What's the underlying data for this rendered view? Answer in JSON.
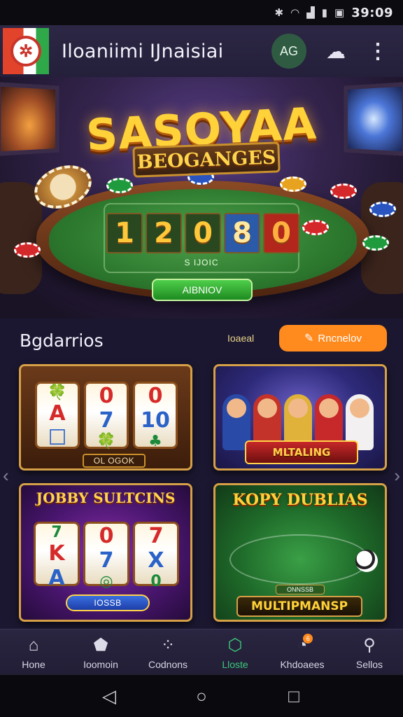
{
  "status_bar": {
    "time": "39:09",
    "icons": [
      "bluetooth-icon",
      "wifi-icon",
      "signal-icon",
      "battery-icon",
      "vibrate-icon"
    ]
  },
  "app_bar": {
    "title": "Iloaniimi IJnaisiai",
    "avatar_initials": "AG",
    "settings_icon": "settings-cloud-icon",
    "more_icon": "more-vertical-icon"
  },
  "hero": {
    "title": "SASOYAA",
    "subtitle": "BEOGANGES",
    "digits": [
      "1",
      "2",
      "0",
      "8",
      "0"
    ],
    "table_caption": "S IJOIC",
    "button_label": "AIBNIOV"
  },
  "section": {
    "title": "Bgdarrios",
    "link_text": "Ioaeal",
    "button_label": "Rncnelov",
    "button_icon": "pencil-icon"
  },
  "games": [
    {
      "name": "slots-classic",
      "caption": "OL OGOK",
      "reels": [
        [
          "🍀",
          "A",
          "☐"
        ],
        [
          "0",
          "7",
          "🍀"
        ],
        [
          "0",
          "10",
          "♣"
        ]
      ]
    },
    {
      "name": "multiplayer-party",
      "banner": "MLTALING"
    },
    {
      "name": "jobby-sultcins",
      "title": "JOBBY SULTCINS",
      "reels": [
        [
          "7",
          "K",
          "A"
        ],
        [
          "0",
          "7",
          "◎"
        ],
        [
          "7",
          "X",
          "0"
        ]
      ],
      "button_label": "IOSSB"
    },
    {
      "name": "kopy-dublias",
      "title": "KOPY DUBLIAS",
      "badge": "ONNSSB",
      "banner": "MULTIPMANSP"
    }
  ],
  "bottom_nav": {
    "items": [
      {
        "label": "Hone",
        "icon": "home-icon"
      },
      {
        "label": "Ioomoin",
        "icon": "pentagon-icon"
      },
      {
        "label": "Codnons",
        "icon": "dots-circle-icon"
      },
      {
        "label": "Lloste",
        "icon": "hexagon-icon",
        "active": true
      },
      {
        "label": "Khdoaees",
        "icon": "clock-badge-icon",
        "badge": "6"
      },
      {
        "label": "Sellos",
        "icon": "person-icon"
      }
    ]
  },
  "colors": {
    "accent_orange": "#ff8a1e",
    "active_green": "#3bcb7a",
    "background": "#1b1730",
    "gold": "#ffd23a"
  }
}
